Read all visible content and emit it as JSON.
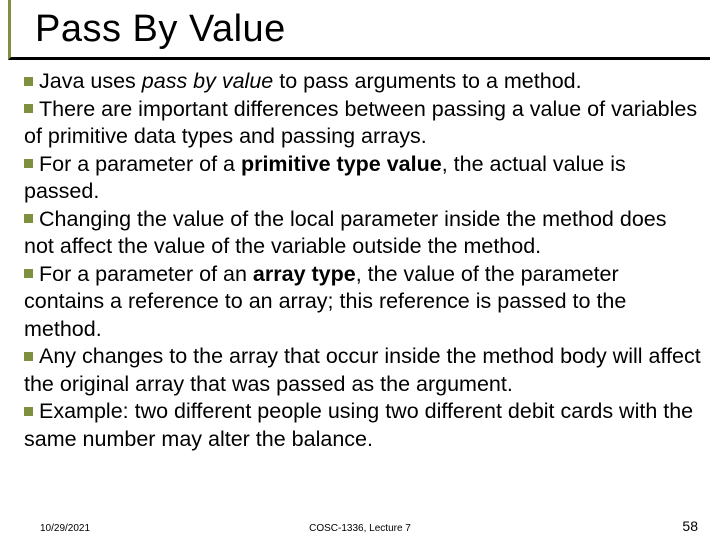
{
  "title": "Pass By Value",
  "bullets": [
    {
      "pre": "Java uses ",
      "ital": "pass by value",
      "post": " to pass arguments to a method."
    },
    {
      "text": "There are important differences between passing a value of variables of primitive data types and passing arrays."
    },
    {
      "pre": "For a parameter of a ",
      "bold": "primitive type value",
      "post": ", the actual value is passed."
    },
    {
      "text": "Changing the value of the local parameter inside the method does not affect the value of the variable outside the method."
    },
    {
      "pre": "For a parameter of an ",
      "bold": "array type",
      "post": ", the value of the parameter contains a reference to an array; this reference is passed to the method."
    },
    {
      "text": "Any changes to the array that occur inside the method body will affect the original array that was passed as the argument."
    },
    {
      "text": "Example: two different people using two different debit cards with the same number may alter the balance."
    }
  ],
  "footer": {
    "date": "10/29/2021",
    "center": "COSC-1336, Lecture 7",
    "page": "58"
  }
}
